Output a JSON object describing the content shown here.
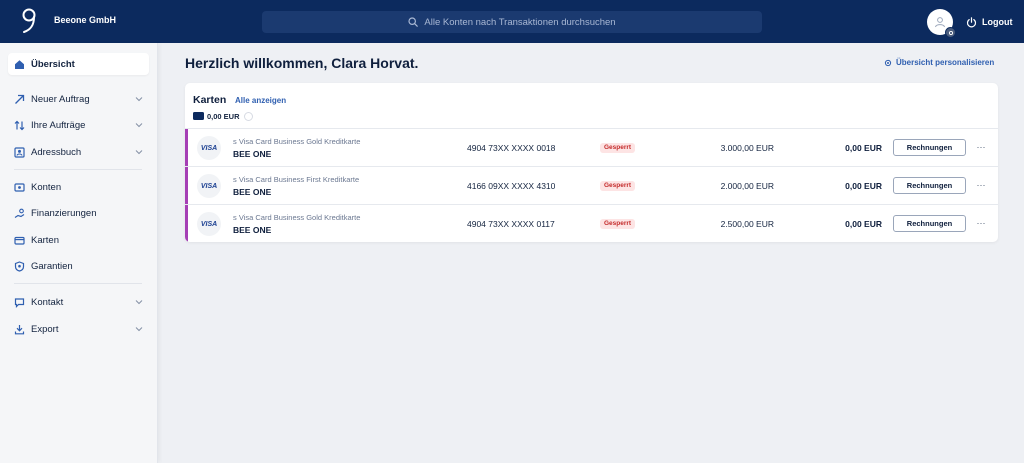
{
  "topbar": {
    "company": "Beeone GmbH",
    "search_placeholder": "Alle Konten nach Transaktionen durchsuchen",
    "logout_label": "Logout"
  },
  "sidebar": {
    "items": [
      {
        "label": "Übersicht",
        "icon": "home-icon",
        "active": true
      },
      {
        "label": "Neuer Auftrag",
        "icon": "arrow-up-right-icon",
        "expandable": true
      },
      {
        "label": "Ihre Aufträge",
        "icon": "swap-icon",
        "expandable": true
      },
      {
        "label": "Adressbuch",
        "icon": "contacts-icon",
        "expandable": true
      },
      {
        "label": "Konten",
        "icon": "accounts-icon"
      },
      {
        "label": "Finanzierungen",
        "icon": "financing-icon"
      },
      {
        "label": "Karten",
        "icon": "card-icon"
      },
      {
        "label": "Garantien",
        "icon": "shield-icon"
      },
      {
        "label": "Kontakt",
        "icon": "chat-icon",
        "expandable": true
      },
      {
        "label": "Export",
        "icon": "download-icon",
        "expandable": true
      }
    ]
  },
  "main": {
    "welcome": "Herzlich willkommen, Clara Horvat.",
    "personalize_label": "Übersicht personalisieren",
    "cards_panel": {
      "title": "Karten",
      "show_all_label": "Alle anzeigen",
      "total": "0,00 EUR",
      "rows": [
        {
          "brand": "VISA",
          "type": "s Visa Card Business Gold Kreditkarte",
          "holder": "BEE ONE",
          "number": "4904 73XX XXXX 0018",
          "status": "Gesperrt",
          "limit": "3.000,00 EUR",
          "balance": "0,00 EUR",
          "action": "Rechnungen",
          "more": "···"
        },
        {
          "brand": "VISA",
          "type": "s Visa Card Business First Kreditkarte",
          "holder": "BEE ONE",
          "number": "4166 09XX XXXX 4310",
          "status": "Gesperrt",
          "limit": "2.000,00 EUR",
          "balance": "0,00 EUR",
          "action": "Rechnungen",
          "more": "···"
        },
        {
          "brand": "VISA",
          "type": "s Visa Card Business Gold Kreditkarte",
          "holder": "BEE ONE",
          "number": "4904 73XX XXXX 0117",
          "status": "Gesperrt",
          "limit": "2.500,00 EUR",
          "balance": "0,00 EUR",
          "action": "Rechnungen",
          "more": "···"
        }
      ]
    }
  },
  "colors": {
    "topbar": "#0c2a5e",
    "accent": "#2f5fb0",
    "row_accent": "#a53fb5",
    "status_bg": "#fde4e4",
    "status_text": "#c42b2b"
  }
}
